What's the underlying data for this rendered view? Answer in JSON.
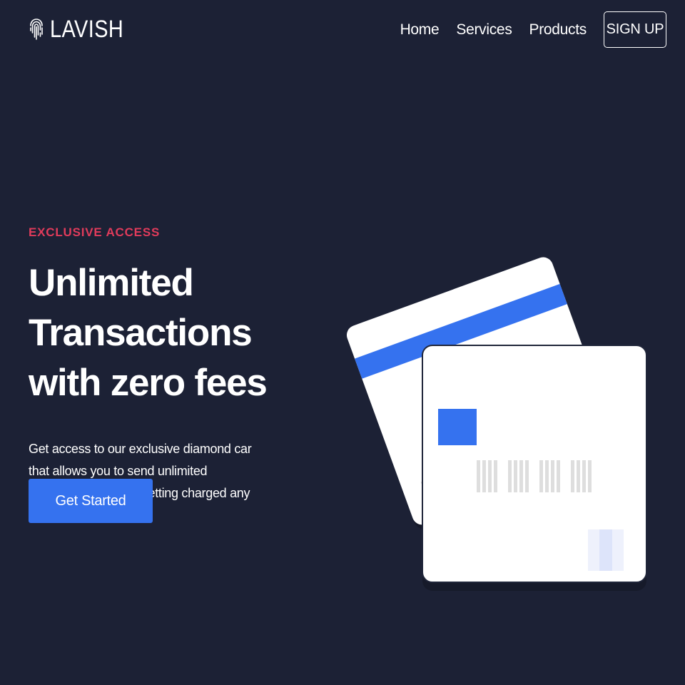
{
  "brand": {
    "logo_icon": "fingerprint-icon",
    "name": "LAVISH"
  },
  "nav": {
    "items": [
      {
        "label": "Home"
      },
      {
        "label": "Services"
      },
      {
        "label": "Products"
      }
    ],
    "signup_label": "SIGN UP"
  },
  "hero": {
    "eyebrow": "EXCLUSIVE ACCESS",
    "headline_line1": "Unlimited Transactions",
    "headline_line2": "with zero fees",
    "description": "Get access to our exclusive diamond car that allows you to send unlimited transactions without getting charged any fees",
    "cta_label": "Get Started"
  },
  "colors": {
    "background": "#1c2135",
    "accent_red": "#e13b5b",
    "primary_blue": "#3572ef",
    "card_white": "#ffffff"
  }
}
